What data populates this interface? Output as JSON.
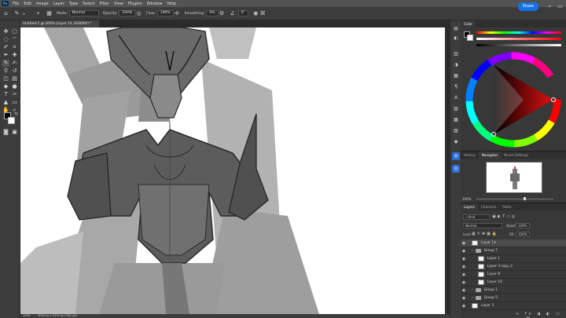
{
  "app": {
    "menu": [
      "File",
      "Edit",
      "Image",
      "Layer",
      "Type",
      "Select",
      "Filter",
      "View",
      "Plugins",
      "Window",
      "Help"
    ],
    "share_label": "Share"
  },
  "options": {
    "mode_label": "Mode:",
    "mode_value": "Normal",
    "opacity_label": "Opacity:",
    "opacity_value": "100%",
    "flow_label": "Flow:",
    "flow_value": "100%",
    "smoothing_label": "Smoothing:",
    "smoothing_value": "0%",
    "angle_value": "0°"
  },
  "document": {
    "tab_title": "Untitled-1 @ 200% (Layer 14, RGB/8#) *",
    "status_zoom": "200%",
    "status_info": "3000 px x 3375 px (300 ppi)"
  },
  "color_panel": {
    "tab": "Color",
    "accent_red": "#e01010",
    "wheel_hue": "red"
  },
  "navigator_panel": {
    "tabs": [
      "History",
      "Navigator",
      "Brush Settings"
    ],
    "zoom": "200%"
  },
  "layers_panel": {
    "tabs": [
      "Layers",
      "Channels",
      "Paths"
    ],
    "filter_label": "Kind",
    "blend_mode": "Normal",
    "opacity_label": "Opacity:",
    "opacity_value": "100%",
    "lock_label": "Lock:",
    "fill_label": "Fill:",
    "fill_value": "100%",
    "layers": [
      {
        "name": "Layer 14",
        "type": "layer",
        "selected": true,
        "indent": 0
      },
      {
        "name": "Group 7",
        "type": "group",
        "selected": false,
        "indent": 0
      },
      {
        "name": "Layer 1",
        "type": "layer",
        "selected": false,
        "indent": 1
      },
      {
        "name": "Layer 3 copy 2",
        "type": "layer",
        "selected": false,
        "indent": 1
      },
      {
        "name": "Layer 8",
        "type": "layer",
        "selected": false,
        "indent": 1
      },
      {
        "name": "Layer 10",
        "type": "layer",
        "selected": false,
        "indent": 1
      },
      {
        "name": "Group 1",
        "type": "group",
        "selected": false,
        "indent": 0
      },
      {
        "name": "Group 5",
        "type": "group",
        "selected": false,
        "indent": 0
      },
      {
        "name": "Layer 3",
        "type": "layer",
        "selected": false,
        "indent": 0
      }
    ]
  }
}
